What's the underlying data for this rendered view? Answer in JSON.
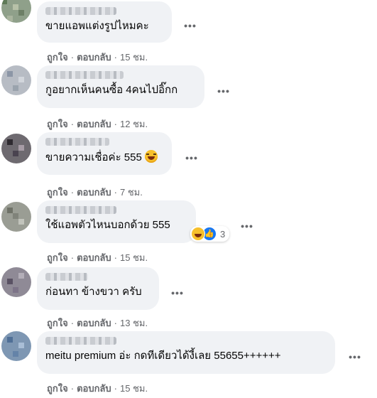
{
  "actions": {
    "like": "ถูกใจ",
    "reply": "ตอบกลับ",
    "separator": "·"
  },
  "more_glyph": "•••",
  "comments": [
    {
      "text": "ขายแอพแต่งรูปไหมคะ",
      "time": "15 ชม."
    },
    {
      "text": "กูอยากเห็นคนซื้อ 4คนไปอิ๊กก",
      "time": "12 ชม."
    },
    {
      "text": "ขายความเชื่อค่ะ 555",
      "time": "7 ชม.",
      "emoji": "laughing-crying-emoji"
    },
    {
      "text": "ใช้แอพตัวไหนบอกด้วย 555",
      "time": "15 ชม.",
      "reaction_count": "3"
    },
    {
      "text": "ก่อนทา ข้างขวา ครับ",
      "time": "13 ชม."
    },
    {
      "text": "meitu premium อ่ะ กดทีเดียวได้งี้เลย 55655++++++",
      "time": "15 ชม."
    }
  ],
  "colors": {
    "bubble": "#f0f2f5",
    "meta": "#65676b",
    "text": "#050505",
    "like_blue": "#1877f2"
  }
}
